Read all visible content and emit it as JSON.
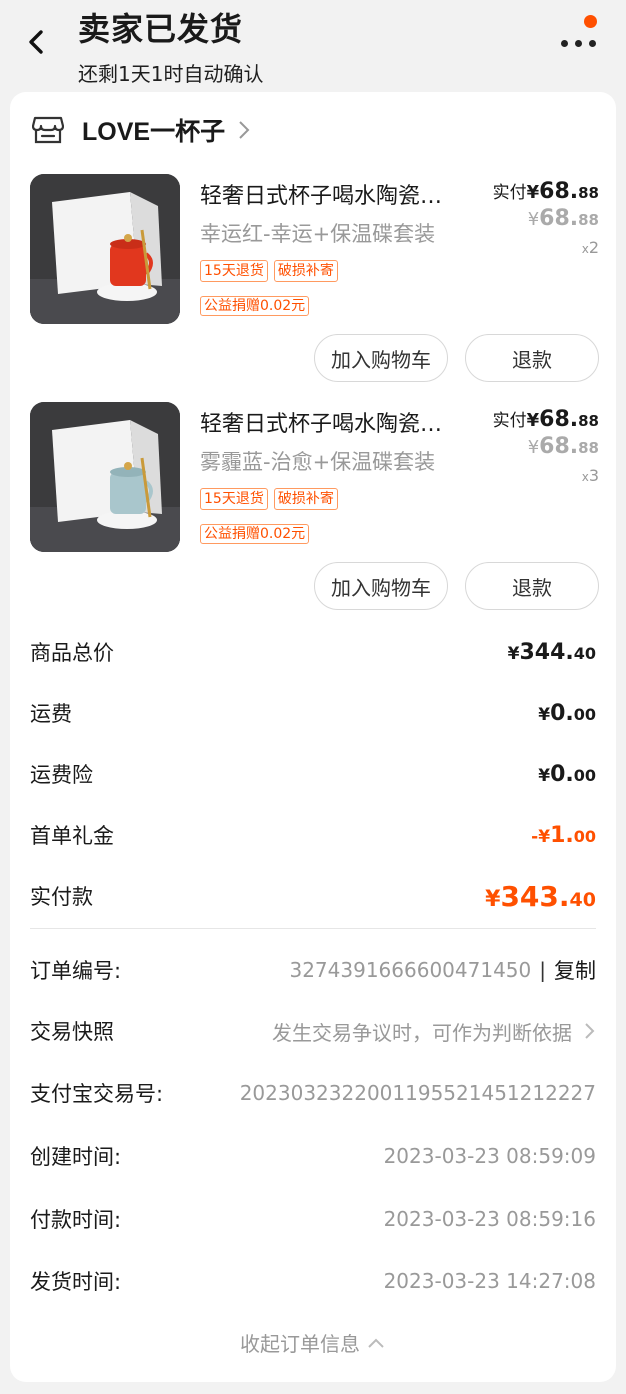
{
  "header": {
    "title": "卖家已发货",
    "subtitle": "还剩1天1时自动确认"
  },
  "shop": {
    "name": "LOVE一杯子"
  },
  "items": [
    {
      "title": "轻奢日式杯子喝水陶瓷…",
      "sku": "幸运红-幸运+保温碟套装",
      "tags": [
        "15天退货",
        "破损补寄"
      ],
      "charity_tag": "公益捐赠0.02元",
      "paid_label": "实付",
      "paid_symbol": "¥",
      "paid_int": "68.",
      "paid_dec": "88",
      "orig_symbol": "¥",
      "orig_int": "68.",
      "orig_dec": "88",
      "qty_x": "x",
      "qty": "2",
      "cart_button": "加入购物车",
      "refund_button": "退款",
      "cup_color": "#e1371e"
    },
    {
      "title": "轻奢日式杯子喝水陶瓷…",
      "sku": "雾霾蓝-治愈+保温碟套装",
      "tags": [
        "15天退货",
        "破损补寄"
      ],
      "charity_tag": "公益捐赠0.02元",
      "paid_label": "实付",
      "paid_symbol": "¥",
      "paid_int": "68.",
      "paid_dec": "88",
      "orig_symbol": "¥",
      "orig_int": "68.",
      "orig_dec": "88",
      "qty_x": "x",
      "qty": "3",
      "cart_button": "加入购物车",
      "refund_button": "退款",
      "cup_color": "#a9c6cc"
    }
  ],
  "summary": {
    "goods_total": {
      "label": "商品总价",
      "sym": "¥",
      "int": "344.",
      "dec": "40"
    },
    "shipping": {
      "label": "运费",
      "sym": "¥",
      "int": "0.",
      "dec": "00"
    },
    "shipping_insurance": {
      "label": "运费险",
      "sym": "¥",
      "int": "0.",
      "dec": "00"
    },
    "first_order_gift": {
      "label": "首单礼金",
      "sym": "-¥",
      "int": "1.",
      "dec": "00"
    },
    "paid_total": {
      "label": "实付款",
      "sym": "¥",
      "int": "343.",
      "dec": "40"
    }
  },
  "order_info": {
    "order_no": {
      "label": "订单编号:",
      "value": "3274391666600471450",
      "sep": "|",
      "copy": "复制"
    },
    "snapshot": {
      "label": "交易快照",
      "value": "发生交易争议时，可作为判断依据"
    },
    "alipay_no": {
      "label": "支付宝交易号:",
      "value": "2023032322001195521451212227"
    },
    "created": {
      "label": "创建时间:",
      "value": "2023-03-23 08:59:09"
    },
    "paid": {
      "label": "付款时间:",
      "value": "2023-03-23 08:59:16"
    },
    "shipped": {
      "label": "发货时间:",
      "value": "2023-03-23 14:27:08"
    }
  },
  "collapse_label": "收起订单信息",
  "colors": {
    "accent": "#ff5000",
    "bg": "#f2f2f2",
    "muted": "#999999"
  },
  "icons": [
    "back-arrow-icon",
    "more-icon",
    "notification-dot",
    "shop-icon",
    "chevron-right-icon",
    "chevron-up-icon"
  ]
}
